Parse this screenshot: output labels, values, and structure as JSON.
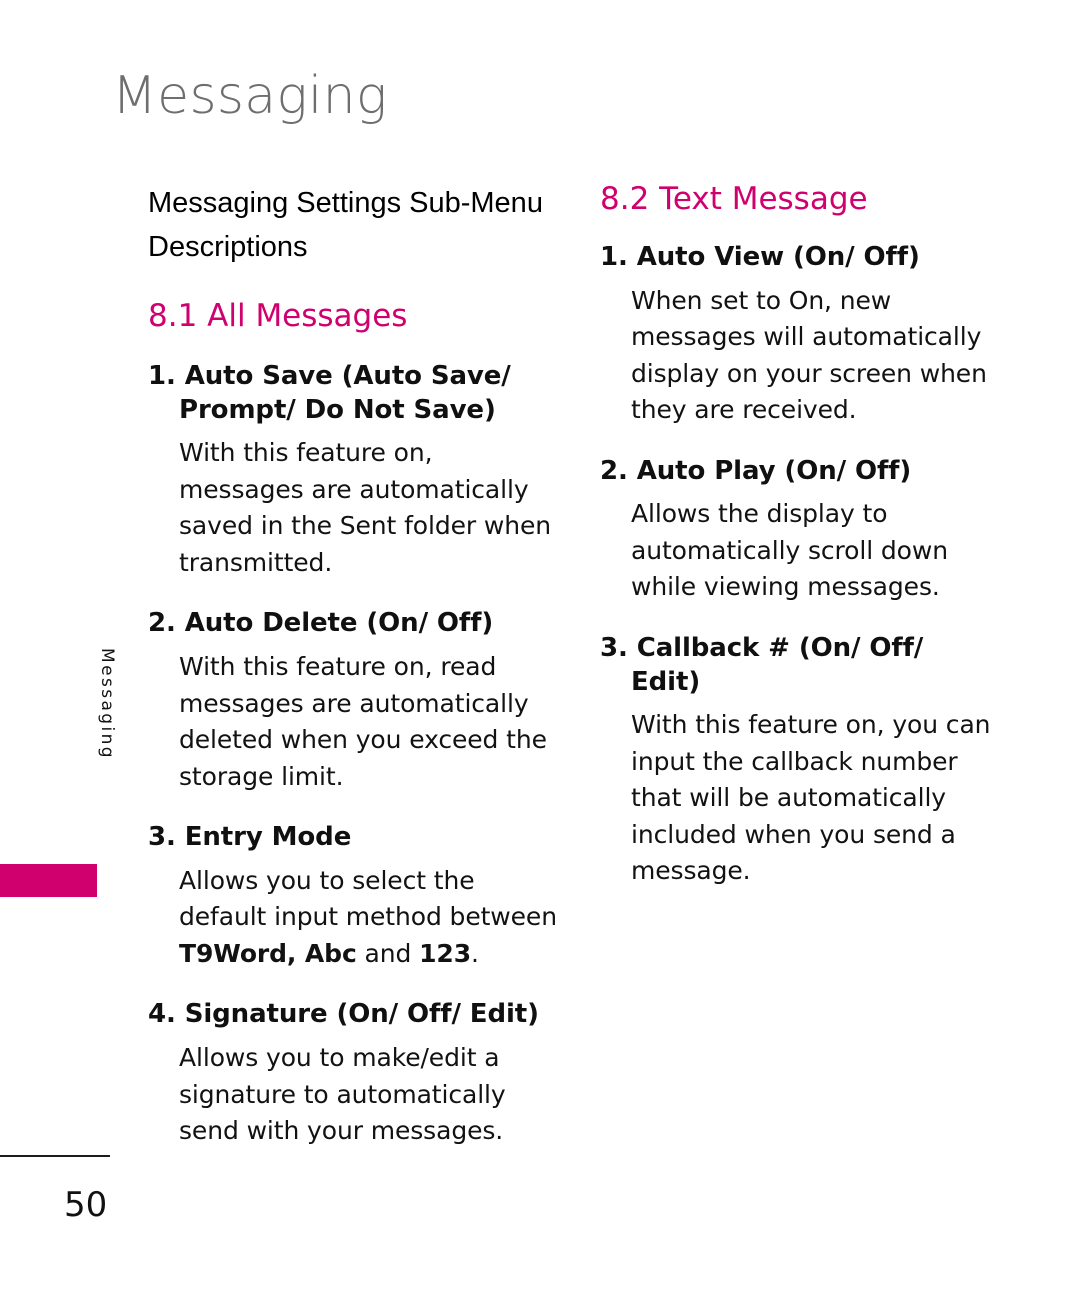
{
  "chapter": {
    "title": "Messaging"
  },
  "side_tab": {
    "label": "Messaging",
    "block_color": "#d0006f"
  },
  "left_column": {
    "sub_menu_heading": "Messaging Settings Sub-Menu Descriptions",
    "section": {
      "number": "8.1",
      "name": "All Messages",
      "heading": "8.1 All Messages",
      "color": "#d0006f"
    },
    "items": [
      {
        "title": "1. Auto Save (Auto Save/ Prompt/ Do Not Save)",
        "body": "With this feature on, messages are automatically saved in the Sent folder when transmitted."
      },
      {
        "title": "2. Auto Delete (On/ Off)",
        "body": "With this feature on, read messages are automatically deleted when you exceed the storage limit."
      },
      {
        "title": "3. Entry Mode",
        "body_html": "Allows you to select the default input method between <b>T9Word, Abc</b> and <b>123</b>.",
        "body": "Allows you to select the default input method between T9Word, Abc and 123."
      },
      {
        "title": "4. Signature (On/ Off/ Edit)",
        "body": "Allows you to make/edit a signature to automatically send with your messages."
      }
    ]
  },
  "right_column": {
    "section": {
      "number": "8.2",
      "name": "Text Message",
      "heading": "8.2 Text Message",
      "color": "#d0006f"
    },
    "items": [
      {
        "title": "1. Auto View (On/ Off)",
        "body": "When set to On, new messages will automatically display on your screen when they are received."
      },
      {
        "title": "2. Auto Play (On/ Off)",
        "body": "Allows the display to automatically scroll down while viewing messages."
      },
      {
        "title": "3. Callback # (On/ Off/ Edit)",
        "body": "With this feature on, you can input the callback number that will be automatically included when you send a message."
      }
    ]
  },
  "footer": {
    "page_number": "50"
  }
}
